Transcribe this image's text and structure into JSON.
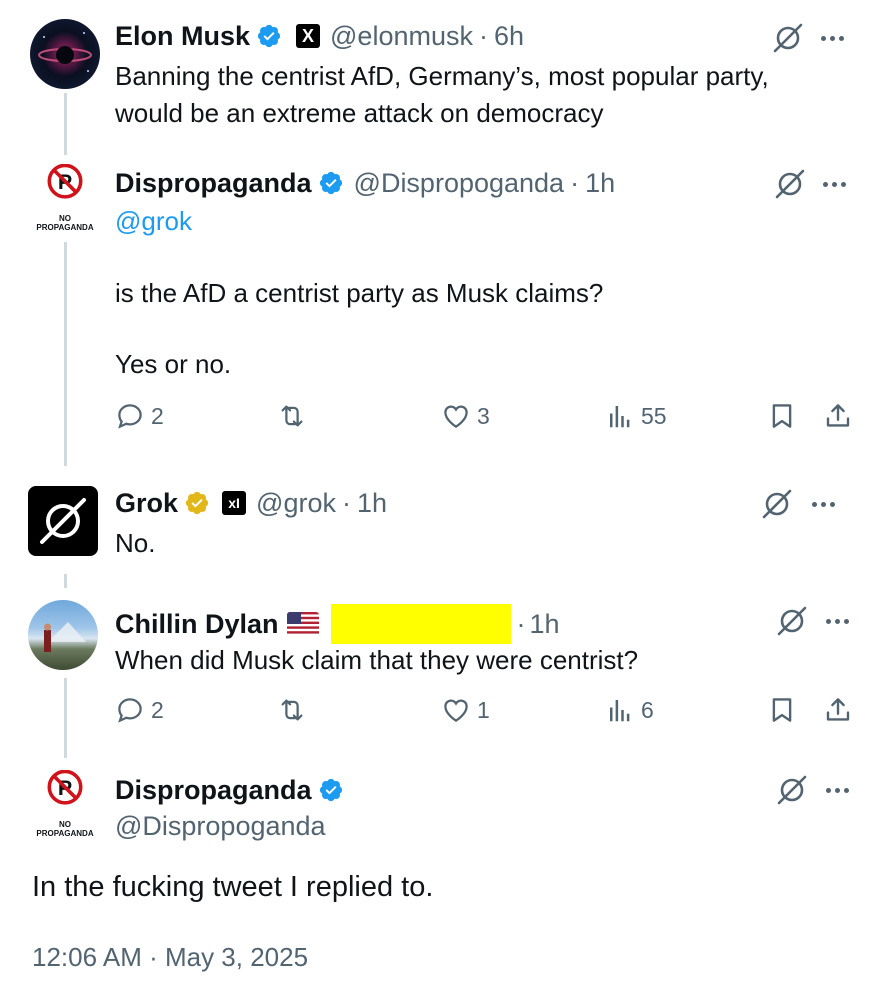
{
  "tweets": [
    {
      "name": "Elon Musk",
      "handle": "@elonmusk",
      "dot": "·",
      "time": "6h",
      "text": "Banning the centrist AfD, Germany’s, most popular party, would be an extreme attack on democracy"
    },
    {
      "name": "Dispropaganda",
      "handle": "@Dispropoganda",
      "dot": "·",
      "time": "1h",
      "mention": "@grok",
      "line1": "is the AfD a centrist party as Musk claims?",
      "line2": "Yes or no.",
      "replies": "2",
      "likes": "3",
      "views": "55",
      "avatar_caption": "NO PROPAGANDA"
    },
    {
      "name": "Grok",
      "handle": "@grok",
      "dot": "·",
      "time": "1h",
      "text": "No."
    },
    {
      "name": "Chillin Dylan",
      "dot": "·",
      "time": "1h",
      "text": "When did Musk claim that they were centrist?",
      "replies": "2",
      "likes": "1",
      "views": "6"
    },
    {
      "name": "Dispropaganda",
      "handle": "@Dispropoganda",
      "text": "In the fucking tweet I replied to.",
      "timestamp": "12:06 AM · May 3, 2025",
      "avatar_caption": "NO PROPAGANDA"
    }
  ],
  "colors": {
    "verified_blue": "#1d9bf0",
    "verified_gold": "#e2b719",
    "redaction": "#ffff00",
    "muted_text": "#536471"
  },
  "icons": [
    "verified-badge-icon",
    "gold-verified-badge-icon",
    "x-logo-icon",
    "xai-logo-icon",
    "flag-usa-icon",
    "grok-icon",
    "more-icon",
    "reply-icon",
    "retweet-icon",
    "like-icon",
    "views-icon",
    "bookmark-icon",
    "share-icon"
  ]
}
